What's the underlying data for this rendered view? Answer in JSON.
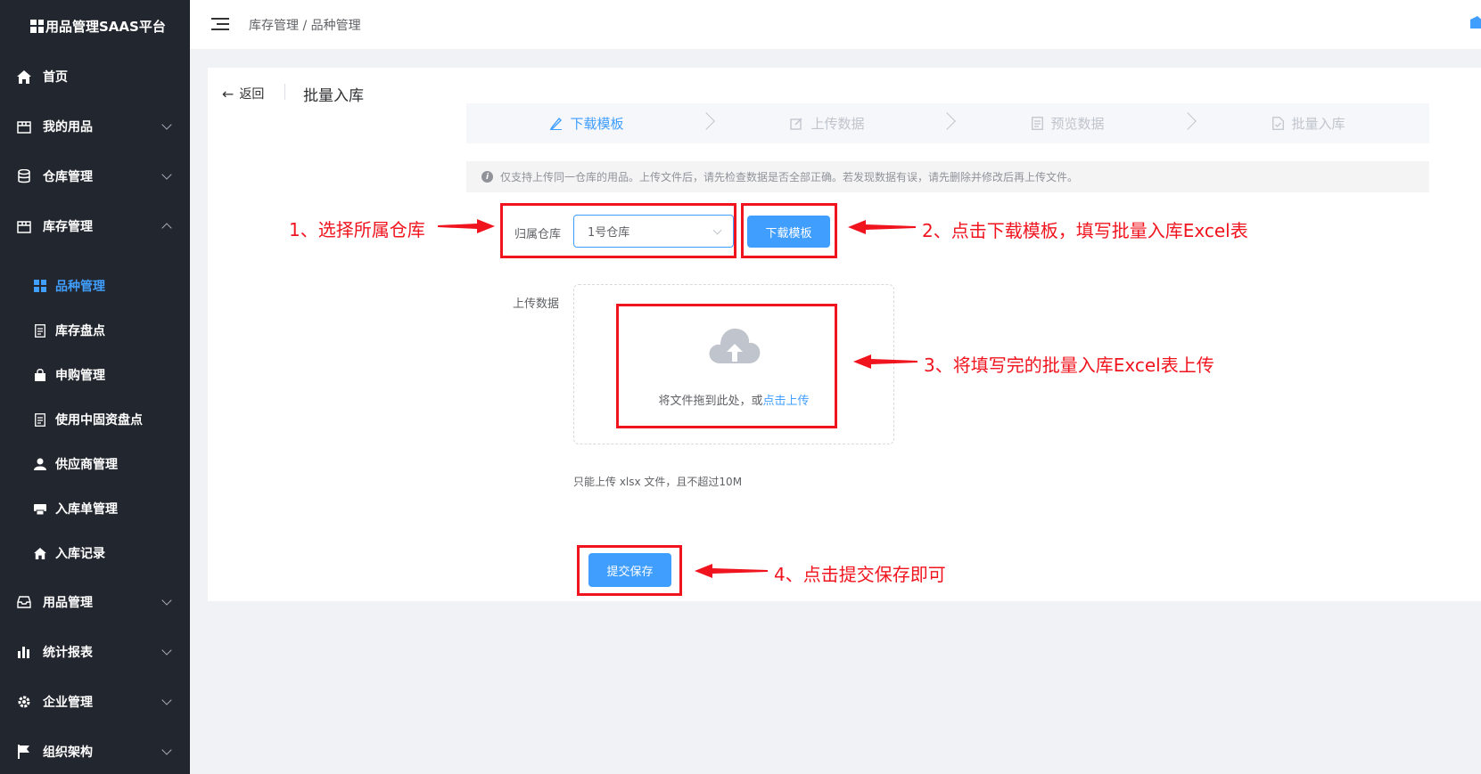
{
  "app": {
    "title": "用品管理SAAS平台"
  },
  "sidebar": {
    "items": [
      {
        "label": "首页",
        "icon": "home-icon"
      },
      {
        "label": "我的用品",
        "icon": "box-icon"
      },
      {
        "label": "仓库管理",
        "icon": "database-icon"
      },
      {
        "label": "库存管理",
        "icon": "inventory-icon"
      },
      {
        "label": "用品管理",
        "icon": "inbox-icon"
      },
      {
        "label": "统计报表",
        "icon": "chart-icon"
      },
      {
        "label": "企业管理",
        "icon": "gear-icon"
      },
      {
        "label": "组织架构",
        "icon": "flag-icon"
      }
    ],
    "subitems": [
      {
        "label": "品种管理",
        "icon": "grid-icon"
      },
      {
        "label": "库存盘点",
        "icon": "document-icon"
      },
      {
        "label": "申购管理",
        "icon": "bag-icon"
      },
      {
        "label": "使用中固资盘点",
        "icon": "document-icon"
      },
      {
        "label": "供应商管理",
        "icon": "user-icon"
      },
      {
        "label": "入库单管理",
        "icon": "printer-icon"
      },
      {
        "label": "入库记录",
        "icon": "home-icon"
      }
    ]
  },
  "header": {
    "breadcrumb": "库存管理 / 品种管理"
  },
  "page": {
    "back": "返回",
    "title": "批量入库",
    "steps": [
      "下载模板",
      "上传数据",
      "预览数据",
      "批量入库"
    ],
    "alert": "仅支持上传同一仓库的用品。上传文件后，请先检查数据是否全部正确。若发现数据有误，请先删除并修改后再上传文件。",
    "warehouse_label": "归属仓库",
    "warehouse_value": "1号仓库",
    "download_button": "下载模板",
    "upload_label": "上传数据",
    "upload_hint": "将文件拖到此处，或",
    "upload_link": "点击上传",
    "upload_tip": "只能上传 xlsx 文件，且不超过10M",
    "submit_button": "提交保存"
  },
  "annotations": {
    "a1": "1、选择所属仓库",
    "a2": "2、点击下载模板，填写批量入库Excel表",
    "a3": "3、将填写完的批量入库Excel表上传",
    "a4": "4、点击提交保存即可"
  },
  "colors": {
    "sidebar_bg": "#22262e",
    "primary": "#409eff",
    "annotation_red": "#f0141e"
  }
}
